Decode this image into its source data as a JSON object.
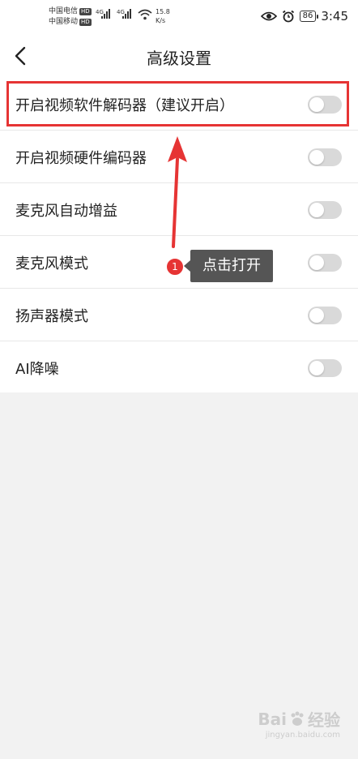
{
  "status_bar": {
    "carrier1": "中国电信",
    "carrier2": "中国移动",
    "hd_badge": "HD",
    "network1": "4G",
    "network2": "4G",
    "net_speed_value": "15.8",
    "net_speed_unit": "K/s",
    "battery": "86",
    "time": "3:45",
    "icons": [
      "eye-icon",
      "alarm-icon",
      "wifi-icon",
      "signal-icon"
    ]
  },
  "header": {
    "title": "高级设置",
    "back_icon": "chevron-left-icon"
  },
  "settings": [
    {
      "label": "开启视频软件解码器（建议开启）",
      "enabled": false
    },
    {
      "label": "开启视频硬件编码器",
      "enabled": false
    },
    {
      "label": "麦克风自动增益",
      "enabled": false
    },
    {
      "label": "麦克风模式",
      "enabled": false
    },
    {
      "label": "扬声器模式",
      "enabled": false
    },
    {
      "label": "AI降噪",
      "enabled": false
    }
  ],
  "annotation": {
    "step_number": "1",
    "tooltip": "点击打开",
    "color": "#e63434"
  },
  "watermark": {
    "brand": "Bai",
    "brand2": "经验",
    "url": "jingyan.baidu.com"
  },
  "colors": {
    "toggle_off": "#d9d9d9",
    "highlight": "#e63434",
    "tooltip_bg": "#555555"
  }
}
